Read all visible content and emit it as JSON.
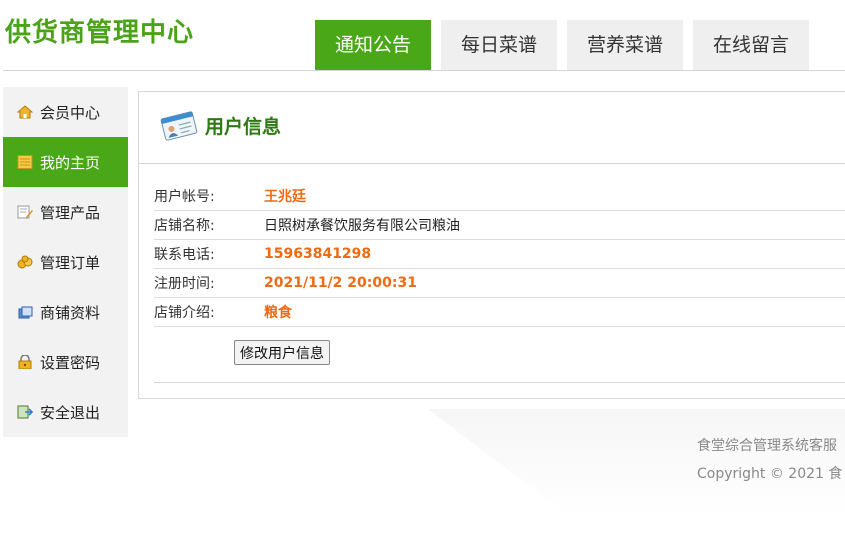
{
  "header": {
    "logo": "供货商管理中心",
    "tabs": [
      {
        "label": "通知公告",
        "active": true
      },
      {
        "label": "每日菜谱",
        "active": false
      },
      {
        "label": "营养菜谱",
        "active": false
      },
      {
        "label": "在线留言",
        "active": false
      }
    ]
  },
  "sidebar": {
    "items": [
      {
        "label": "会员中心",
        "icon": "home-icon",
        "active": false
      },
      {
        "label": "我的主页",
        "icon": "page-icon",
        "active": true
      },
      {
        "label": "管理产品",
        "icon": "edit-icon",
        "active": false
      },
      {
        "label": "管理订单",
        "icon": "order-icon",
        "active": false
      },
      {
        "label": "商铺资料",
        "icon": "store-icon",
        "active": false
      },
      {
        "label": "设置密码",
        "icon": "lock-icon",
        "active": false
      },
      {
        "label": "安全退出",
        "icon": "exit-icon",
        "active": false
      }
    ]
  },
  "panel": {
    "title": "用户信息",
    "rows": [
      {
        "label": "用户帐号:",
        "value": "王兆廷"
      },
      {
        "label": "店铺名称:",
        "value": "日照树承餐饮服务有限公司粮油"
      },
      {
        "label": "联系电话:",
        "value": "15963841298"
      },
      {
        "label": "注册时间:",
        "value": "2021/11/2 20:00:31"
      },
      {
        "label": "店铺介绍:",
        "value": "粮食"
      }
    ],
    "edit_button": "修改用户信息"
  },
  "footer": {
    "line1": "食堂综合管理系统客服",
    "line2": "Copyright © 2021 食"
  },
  "colors": {
    "accent": "#4aa818",
    "logo": "#4aa318",
    "value": "#ee6a14",
    "title": "#2d7a12"
  }
}
